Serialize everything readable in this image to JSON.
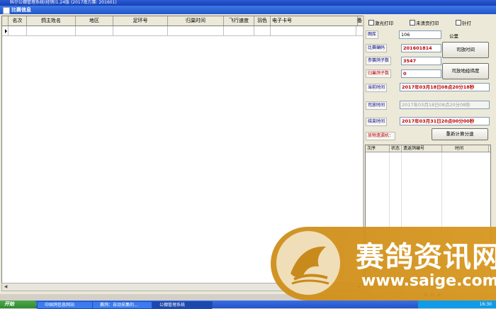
{
  "window": {
    "title": "科尔公棚管理系统(经销)1.24版 (2017南方赛: 201601)"
  },
  "mdi": {
    "title": "比赛信息"
  },
  "grid": {
    "columns": [
      "名次",
      "鸽主姓名",
      "地区",
      "足环号",
      "归巢时间",
      "飞行速度",
      "羽色",
      "电子卡号",
      "备"
    ]
  },
  "options": {
    "laser_print": "激光打印",
    "no_blank_print": "未清页打印",
    "pin_print": "针打",
    "nest_label": "图库",
    "nest_value": "106",
    "unit_label": "公里"
  },
  "fields": [
    {
      "label": "比赛编码",
      "value": "201601814",
      "red": true
    },
    {
      "label": "参赛鸽子数",
      "value": "3547",
      "red": true
    },
    {
      "label": "归巢鸽子数",
      "value": "0",
      "red": true
    },
    {
      "label": "当前时间",
      "value": "2017年03月18日08点20分18秒",
      "red": true
    },
    {
      "label": "司放时间",
      "value": "2017年03月18日08点20分08秒",
      "red": false
    },
    {
      "label": "结束时间",
      "value": "2017年03月31日20点00分00秒",
      "red": true
    }
  ],
  "buttons": {
    "release": "司放时间",
    "coords": "司放地经纬度",
    "recalc": "重新计算分速"
  },
  "reader_label": "放物遗漏机：",
  "log": {
    "columns": [
      "次序",
      "状态",
      "遗返鸽编号",
      "时间"
    ]
  },
  "taskbar": {
    "start": "开始",
    "tasks": [
      "中国鸽信息网站",
      "赛鸽：自动采集的...",
      "公棚管理系统"
    ],
    "clock": "16:30"
  },
  "watermark": {
    "cn": "赛鸽资讯网",
    "url": "www.saige.com"
  }
}
